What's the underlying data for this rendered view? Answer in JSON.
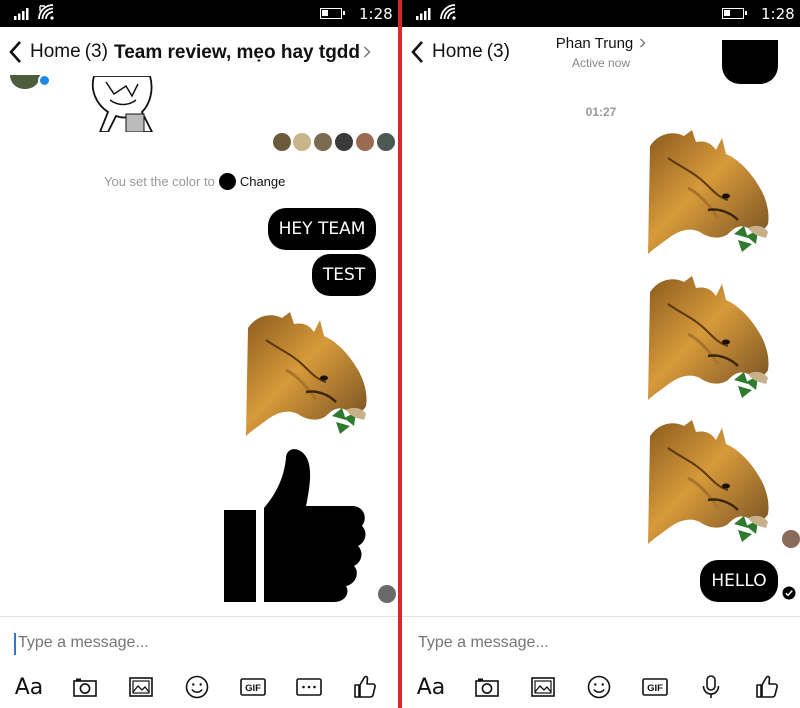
{
  "status_bar": {
    "time": "1:28"
  },
  "left_pane": {
    "header": {
      "home_label": "Home",
      "home_count": "(3)",
      "title": "Team review, mẹo hay tgdd"
    },
    "system_message": {
      "text": "You set the color to",
      "change_label": "Change"
    },
    "messages": [
      "HEY TEAM",
      "TEST"
    ],
    "composer": {
      "placeholder": "Type a message...",
      "tools": [
        "text-format",
        "camera",
        "gallery",
        "emoji",
        "gif",
        "more",
        "like"
      ],
      "text_format_label": "Aa",
      "gif_label": "GIF"
    }
  },
  "right_pane": {
    "header": {
      "home_label": "Home",
      "home_count": "(3)",
      "contact_name": "Phan Trung",
      "status": "Active now"
    },
    "timestamp": "01:27",
    "messages": [
      "HELLO"
    ],
    "composer": {
      "placeholder": "Type a message...",
      "tools": [
        "text-format",
        "camera",
        "gallery",
        "emoji",
        "gif",
        "microphone",
        "like"
      ],
      "text_format_label": "Aa",
      "gif_label": "GIF"
    }
  },
  "colors": {
    "divider": "#d42a2f",
    "bubble": "#000000",
    "caret": "#3a75c4",
    "messenger_badge": "#1e88e5"
  }
}
